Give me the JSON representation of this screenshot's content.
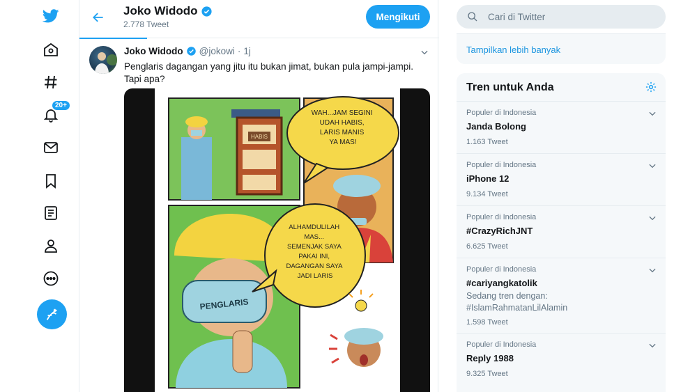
{
  "colors": {
    "accent": "#1da1f2",
    "link": "#1b95e0",
    "muted": "#657786"
  },
  "nav": {
    "items": [
      {
        "icon": "twitter-logo-icon"
      },
      {
        "icon": "home-icon"
      },
      {
        "icon": "explore-hashtag-icon"
      },
      {
        "icon": "notifications-bell-icon",
        "badge": "20+"
      },
      {
        "icon": "messages-envelope-icon"
      },
      {
        "icon": "bookmark-icon"
      },
      {
        "icon": "lists-icon"
      },
      {
        "icon": "profile-person-icon"
      },
      {
        "icon": "more-dots-icon"
      },
      {
        "icon": "compose-tweet-icon"
      }
    ]
  },
  "header": {
    "name": "Joko Widodo",
    "tweet_count": "2.778 Tweet",
    "follow_label": "Mengikuti"
  },
  "tweet": {
    "name": "Joko Widodo",
    "handle": "@jokowi",
    "separator": "·",
    "time": "1j",
    "text": "Penglaris dagangan yang jitu itu bukan jimat, bukan pula jampi-jampi. Tapi apa?",
    "comic": {
      "bubble1": [
        "WAH...JAM SEGINI",
        "UDAH HABIS,",
        "LARIS MANIS",
        "YA MAS!"
      ],
      "sign": "HABIS",
      "bubble2": [
        "ALHAMDULILAH",
        "MAS...",
        "SEMENJAK SAYA",
        "PAKAI INI,",
        "DAGANGAN SAYA",
        "JADI LARIS"
      ],
      "mask_text": "PENGLARIS"
    }
  },
  "search": {
    "placeholder": "Cari di Twitter"
  },
  "more": {
    "label": "Tampilkan lebih banyak"
  },
  "trends": {
    "title": "Tren untuk Anda",
    "items": [
      {
        "category": "Populer di Indonesia",
        "name": "Janda Bolong",
        "context": "",
        "count": "1.163 Tweet"
      },
      {
        "category": "Populer di Indonesia",
        "name": "iPhone 12",
        "context": "",
        "count": "9.134 Tweet"
      },
      {
        "category": "Populer di Indonesia",
        "name": "#CrazyRichJNT",
        "context": "",
        "count": "6.625 Tweet"
      },
      {
        "category": "Populer di Indonesia",
        "name": "#cariyangkatolik",
        "context_label": "Sedang tren dengan:",
        "context": "#IslamRahmatanLilAlamin",
        "count": "1.598 Tweet"
      },
      {
        "category": "Populer di Indonesia",
        "name": "Reply 1988",
        "context": "",
        "count": "9.325 Tweet"
      }
    ]
  }
}
